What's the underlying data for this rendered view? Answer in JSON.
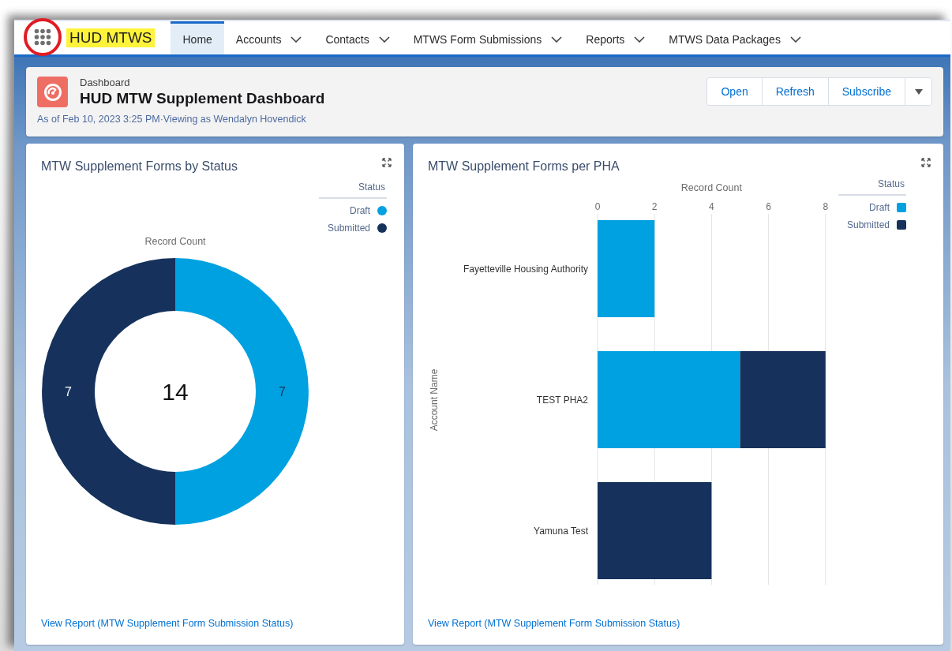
{
  "app_name": "HUD MTWS",
  "nav_tabs": [
    {
      "label": "Home",
      "selected": true,
      "has_menu": false
    },
    {
      "label": "Accounts",
      "selected": false,
      "has_menu": true
    },
    {
      "label": "Contacts",
      "selected": false,
      "has_menu": true
    },
    {
      "label": "MTWS Form Submissions",
      "selected": false,
      "has_menu": true
    },
    {
      "label": "Reports",
      "selected": false,
      "has_menu": true
    },
    {
      "label": "MTWS Data Packages",
      "selected": false,
      "has_menu": true
    }
  ],
  "header": {
    "object_label": "Dashboard",
    "title": "HUD MTW Supplement Dashboard",
    "subtitle": "As of Feb 10, 2023 3:25 PM·Viewing as Wendalyn Hovendick",
    "buttons": [
      "Open",
      "Refresh",
      "Subscribe"
    ]
  },
  "cards": [
    {
      "title": "MTW Supplement Forms by Status",
      "legend_title": "Status",
      "link": "View Report (MTW Supplement Form Submission Status)",
      "chart_data": {
        "type": "donut",
        "categories": [
          "Draft",
          "Submitted"
        ],
        "colors": [
          "#00a1e0",
          "#16325c"
        ],
        "series": [
          {
            "name": "Record Count",
            "values": [
              7,
              7
            ]
          }
        ],
        "data_labels": true,
        "annotations": [
          {
            "text": "14"
          }
        ]
      }
    },
    {
      "title": "MTW Supplement Forms per PHA",
      "legend_title": "Status",
      "link": "View Report (MTW Supplement Form Submission Status)",
      "chart_data": {
        "type": "bar",
        "orientation": "horizontal",
        "stacked": true,
        "xlabel": "Record Count",
        "ylabel": "Account Name",
        "categories": [
          "Fayetteville Housing Authority",
          "TEST PHA2",
          "Yamuna Test"
        ],
        "series": [
          {
            "name": "Draft",
            "color": "#00a1e0",
            "values": [
              2,
              5,
              0
            ]
          },
          {
            "name": "Submitted",
            "color": "#16325c",
            "values": [
              0,
              3,
              4
            ]
          }
        ],
        "xlim": [
          0,
          8
        ],
        "xticks": [
          0,
          2,
          4,
          6,
          8
        ],
        "grid": true
      }
    }
  ]
}
